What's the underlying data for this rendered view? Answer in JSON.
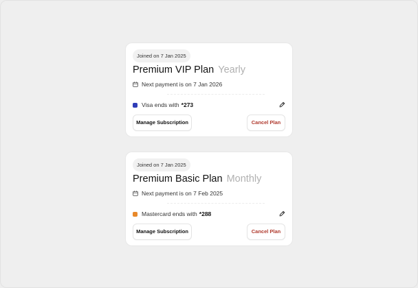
{
  "subscriptions": [
    {
      "joined_label": "Joined on 7 Jan 2025",
      "plan_name": "Premium VIP Plan",
      "billing_period": "Yearly",
      "next_payment_label": "Next payment is on 7 Jan 2026",
      "card_label": "Visa ends with",
      "card_digits": "*273",
      "card_color": "#2f3db8",
      "manage_label": "Manage Subscription",
      "cancel_label": "Cancel Plan"
    },
    {
      "joined_label": "Joined on 7 Jan 2025",
      "plan_name": "Premium Basic Plan",
      "billing_period": "Monthly",
      "next_payment_label": "Next payment is on 7 Feb 2025",
      "card_label": "Mastercard ends with",
      "card_digits": "*288",
      "card_color": "#e8892a",
      "manage_label": "Manage Subscription",
      "cancel_label": "Cancel Plan"
    }
  ],
  "icons": {
    "calendar": "calendar-icon",
    "edit": "pencil-icon"
  },
  "colors": {
    "cancel_text": "#b03a2e",
    "period_text": "#b0b0b0"
  }
}
